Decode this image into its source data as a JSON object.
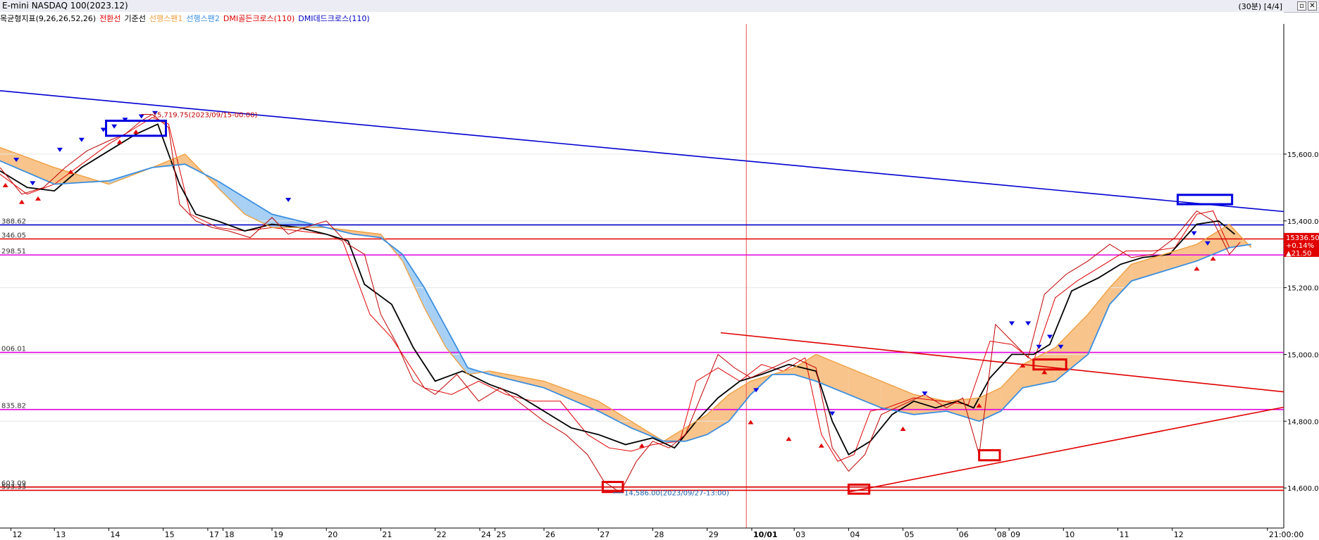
{
  "window": {
    "title": "E-mini NASDAQ 100(2023.12)",
    "period": "(30분) [4/4]",
    "buttons": [
      "▫",
      "✕"
    ]
  },
  "legend": [
    {
      "text": "목균형지표(9,26,26,52,26)",
      "color": "#000000"
    },
    {
      "text": "전환선",
      "color": "#e00000"
    },
    {
      "text": "기준선",
      "color": "#000000"
    },
    {
      "text": "선행스팬1",
      "color": "#f0a040"
    },
    {
      "text": "선행스팬2",
      "color": "#3a8ee0"
    },
    {
      "text": "DMI골든크로스(110)",
      "color": "#e00000"
    },
    {
      "text": "DMI데드크로스(110)",
      "color": "#0000c8"
    }
  ],
  "colors": {
    "price": "#c00000",
    "conversion": "#e00000",
    "base": "#000000",
    "span1": "#f0a040",
    "span2": "#3a8ee0",
    "cloud_bull": "#f8c48c",
    "cloud_bear": "#a8d0f4",
    "downtrend": "#0000d0",
    "triangle": "#e00000",
    "hline_blue": "#0000c8",
    "hline_red": "#e00000",
    "hline_magenta": "#e000e0",
    "highlight_blue": "#0000e0",
    "highlight_red": "#e00000"
  },
  "chart_data": {
    "type": "line",
    "title": "E-mini NASDAQ 100(2023.12)",
    "timeframe": "30분",
    "xlabel": "",
    "ylabel": "",
    "ylim": [
      14480,
      15990
    ],
    "yticks": [
      "15,600.00",
      "15,400.00",
      "15,200.00",
      "15,000.00",
      "14,800.00",
      "14,600.00"
    ],
    "ytick_values": [
      15600,
      15400,
      15200,
      15000,
      14800,
      14600
    ],
    "x_labels": [
      "12",
      "13",
      "14",
      "15",
      "17",
      "18",
      "19",
      "20",
      "21",
      "22",
      "24",
      "25",
      "26",
      "27",
      "28",
      "29",
      "10/01",
      "03",
      "04",
      "05",
      "06",
      "08",
      "09",
      "10",
      "11",
      "12",
      "21:00:00"
    ],
    "x_label_pos": [
      0.2,
      1,
      2,
      3,
      3.82,
      4.1,
      5,
      6,
      7,
      8,
      8.82,
      9.1,
      10,
      11,
      12,
      13,
      13.82,
      14.6,
      15.6,
      16.6,
      17.6,
      18.3,
      18.55,
      19.55,
      20.55,
      21.55,
      23.3
    ],
    "x_range": [
      0,
      23.6
    ],
    "cursor_x": 13.72,
    "horizontal_lines": [
      {
        "value": 15388,
        "label": "388.62",
        "color": "blue"
      },
      {
        "value": 15346,
        "label": "346.05",
        "color": "red"
      },
      {
        "value": 15298,
        "label": "298.51",
        "color": "magenta"
      },
      {
        "value": 15006,
        "label": "006.01",
        "color": "magenta"
      },
      {
        "value": 14835,
        "label": "835.82",
        "color": "magenta"
      },
      {
        "value": 14603,
        "label": "603.09",
        "color": "red"
      },
      {
        "value": 14593,
        "label": "593.33",
        "color": "red"
      }
    ],
    "trend_lines": [
      {
        "x": [
          0,
          23.6
        ],
        "y": [
          15790,
          15428
        ],
        "color": "downtrend"
      },
      {
        "x": [
          13.25,
          23.6
        ],
        "y": [
          15065,
          14888
        ],
        "color": "triangle"
      },
      {
        "x": [
          15.6,
          23.6
        ],
        "y": [
          14588,
          14842
        ],
        "color": "triangle"
      }
    ],
    "annotations": [
      {
        "text": "15,719.75(2023/09/15-00:00)",
        "x": 2.78,
        "y": 15719,
        "color": "#c00000"
      },
      {
        "text": "14,586.00(2023/09/27-13:00)",
        "x": 11.45,
        "y": 14586,
        "color": "#1a5ea8"
      }
    ],
    "highlight_boxes": [
      {
        "x": [
          1.95,
          3.05
        ],
        "y": [
          15655,
          15700
        ],
        "color": "blue"
      },
      {
        "x": [
          21.65,
          22.65
        ],
        "y": [
          15450,
          15478
        ],
        "color": "blue"
      },
      {
        "x": [
          11.08,
          11.45
        ],
        "y": [
          14588,
          14618
        ],
        "color": "red"
      },
      {
        "x": [
          15.6,
          15.98
        ],
        "y": [
          14583,
          14610
        ],
        "color": "red"
      },
      {
        "x": [
          18.0,
          18.38
        ],
        "y": [
          14683,
          14713
        ],
        "color": "red"
      },
      {
        "x": [
          19.0,
          19.6
        ],
        "y": [
          14955,
          14985
        ],
        "color": "red"
      }
    ],
    "last": {
      "price": "15336.50",
      "change": "+0.14%",
      "diff": "▲21.50",
      "value": 15336.5
    },
    "series": [
      {
        "name": "전환선",
        "x": [
          0,
          0.5,
          1,
          1.5,
          2,
          2.5,
          2.8,
          3.1,
          3.5,
          4,
          4.5,
          5,
          5.5,
          6,
          6.3,
          6.8,
          7.2,
          7.8,
          8.3,
          8.8,
          9.3,
          9.8,
          10.3,
          10.8,
          11.2,
          11.6,
          12,
          12.5,
          12.8,
          13.2,
          13.6,
          14,
          14.4,
          14.8,
          15.1,
          15.4,
          15.7,
          16,
          16.3,
          16.8,
          17.3,
          17.8,
          18.2,
          18.6,
          19,
          19.4,
          19.8,
          20.3,
          20.7,
          21.2,
          21.6,
          22,
          22.3,
          22.6
        ],
        "y": [
          15540,
          15480,
          15510,
          15570,
          15630,
          15680,
          15710,
          15690,
          15420,
          15380,
          15370,
          15380,
          15370,
          15360,
          15340,
          15120,
          15050,
          14900,
          14880,
          14920,
          14880,
          14860,
          14860,
          14760,
          14720,
          14710,
          14730,
          14740,
          14920,
          14960,
          14920,
          14970,
          14950,
          14990,
          14760,
          14680,
          14700,
          14830,
          14840,
          14870,
          14860,
          14850,
          15040,
          15030,
          14980,
          15170,
          15220,
          15270,
          15310,
          15310,
          15320,
          15420,
          15430,
          15320
        ]
      },
      {
        "name": "기준선",
        "x": [
          0,
          0.5,
          1,
          1.5,
          2,
          2.5,
          2.9,
          3.3,
          3.6,
          4,
          4.5,
          5,
          5.5,
          6,
          6.4,
          6.7,
          7.2,
          7.6,
          8,
          8.5,
          9,
          9.5,
          10,
          10.5,
          11,
          11.5,
          12,
          12.4,
          12.8,
          13.2,
          13.6,
          14,
          14.5,
          15,
          15.3,
          15.6,
          16,
          16.4,
          16.8,
          17.2,
          17.6,
          17.9,
          18.2,
          18.6,
          19,
          19.3,
          19.7,
          20.2,
          20.6,
          21,
          21.5,
          22,
          22.4,
          22.7
        ],
        "y": [
          15550,
          15500,
          15490,
          15560,
          15610,
          15660,
          15690,
          15510,
          15420,
          15400,
          15370,
          15390,
          15380,
          15360,
          15340,
          15210,
          15150,
          15020,
          14920,
          14950,
          14910,
          14880,
          14830,
          14780,
          14760,
          14730,
          14750,
          14720,
          14800,
          14870,
          14920,
          14940,
          14970,
          14950,
          14800,
          14700,
          14740,
          14820,
          14860,
          14840,
          14860,
          14840,
          14930,
          15000,
          15000,
          15030,
          15190,
          15230,
          15270,
          15290,
          15300,
          15390,
          15400,
          15360
        ]
      },
      {
        "name": "선행스팬1",
        "x": [
          0,
          1,
          2,
          2.8,
          3.4,
          4,
          4.5,
          5,
          6,
          6.5,
          7,
          7.4,
          7.8,
          8.2,
          8.6,
          9,
          10,
          11,
          11.6,
          12.2,
          12.6,
          13,
          13.4,
          13.8,
          14.2,
          14.6,
          15,
          15.6,
          16.2,
          16.8,
          17.4,
          18,
          18.4,
          18.8,
          19.4,
          20,
          20.4,
          20.8,
          21.4,
          22,
          22.6,
          23
        ],
        "y": [
          15620,
          15560,
          15510,
          15560,
          15600,
          15500,
          15420,
          15380,
          15380,
          15370,
          15360,
          15280,
          15140,
          15020,
          14940,
          14950,
          14920,
          14860,
          14800,
          14740,
          14780,
          14820,
          14880,
          14920,
          14940,
          14960,
          15000,
          14960,
          14920,
          14880,
          14860,
          14870,
          14900,
          14970,
          15020,
          15120,
          15200,
          15270,
          15300,
          15330,
          15390,
          15320
        ]
      },
      {
        "name": "선행스팬2",
        "x": [
          0,
          1,
          2,
          2.8,
          3.4,
          4,
          4.5,
          5,
          6,
          6.5,
          7,
          7.4,
          7.8,
          8.2,
          8.6,
          9,
          10,
          11,
          11.6,
          12.2,
          12.6,
          13,
          13.4,
          13.8,
          14.2,
          14.6,
          15,
          15.6,
          16.2,
          16.8,
          17.4,
          18,
          18.4,
          18.8,
          19.4,
          20,
          20.4,
          20.8,
          21.4,
          22,
          22.6,
          23
        ],
        "y": [
          15580,
          15510,
          15520,
          15560,
          15570,
          15520,
          15470,
          15420,
          15380,
          15360,
          15350,
          15300,
          15200,
          15080,
          14960,
          14940,
          14900,
          14830,
          14780,
          14740,
          14740,
          14760,
          14800,
          14880,
          14940,
          14940,
          14920,
          14880,
          14840,
          14820,
          14830,
          14800,
          14830,
          14900,
          14920,
          15000,
          15150,
          15220,
          15250,
          15280,
          15320,
          15330
        ]
      },
      {
        "name": "price",
        "x": [
          0,
          0.4,
          0.8,
          1.2,
          1.6,
          2,
          2.3,
          2.6,
          2.8,
          3.1,
          3.3,
          3.6,
          3.9,
          4.2,
          4.6,
          5,
          5.3,
          5.6,
          6,
          6.4,
          6.7,
          7,
          7.3,
          7.6,
          8,
          8.4,
          8.8,
          9.2,
          9.6,
          10,
          10.4,
          10.8,
          11.1,
          11.4,
          11.7,
          12,
          12.3,
          12.6,
          12.9,
          13.2,
          13.5,
          13.8,
          14.2,
          14.6,
          15,
          15.3,
          15.6,
          15.9,
          16.2,
          16.6,
          17,
          17.4,
          17.7,
          18,
          18.3,
          18.6,
          18.9,
          19.2,
          19.6,
          20,
          20.4,
          20.8,
          21.2,
          21.6,
          22,
          22.3,
          22.6,
          22.8
        ],
        "y": [
          15560,
          15480,
          15500,
          15560,
          15610,
          15640,
          15660,
          15700,
          15719,
          15680,
          15450,
          15400,
          15380,
          15370,
          15350,
          15410,
          15360,
          15380,
          15400,
          15330,
          15300,
          15120,
          15030,
          14920,
          14880,
          14940,
          14860,
          14900,
          14850,
          14800,
          14760,
          14700,
          14620,
          14586,
          14680,
          14740,
          14720,
          14760,
          14880,
          15000,
          14960,
          14930,
          14960,
          14990,
          14960,
          14720,
          14650,
          14700,
          14820,
          14850,
          14880,
          14840,
          14870,
          14700,
          15090,
          15040,
          14990,
          15180,
          15240,
          15280,
          15330,
          15290,
          15300,
          15350,
          15430,
          15400,
          15300,
          15336.5
        ]
      }
    ],
    "signals": [
      {
        "type": "dead",
        "x": [
          0.3,
          0.6,
          1.1,
          1.5,
          1.9,
          2.1,
          2.3,
          2.6,
          2.85,
          5.3,
          13.9,
          15.3,
          17.0,
          18.6,
          18.9,
          19.1,
          19.3,
          19.5,
          21.95,
          22.2
        ],
        "y": [
          15570,
          15500,
          15600,
          15630,
          15660,
          15670,
          15690,
          15700,
          15710,
          15450,
          14880,
          14810,
          14870,
          15080,
          15080,
          15010,
          15040,
          15010,
          15350,
          15320
        ]
      },
      {
        "type": "golden",
        "x": [
          0.1,
          0.4,
          0.7,
          1.3,
          2.2,
          2.5,
          11.8,
          13.8,
          14.5,
          15.1,
          16.6,
          18.0,
          18.8,
          19.2,
          22.0,
          22.3
        ],
        "y": [
          15520,
          15470,
          15480,
          15560,
          15650,
          15680,
          14740,
          14810,
          14760,
          14740,
          14790,
          14860,
          14980,
          14960,
          15270,
          15300
        ]
      }
    ]
  }
}
